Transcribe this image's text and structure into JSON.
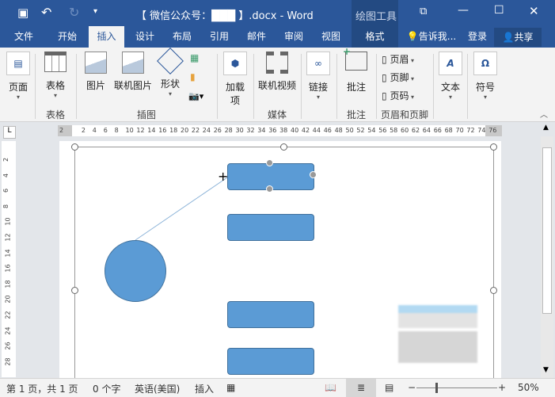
{
  "title_bar": {
    "document_title": "【 微信公众号：███ 】.docx - Word",
    "context_group": "绘图工具",
    "quick_access": [
      "save",
      "undo",
      "redo",
      "customize"
    ],
    "window_controls": [
      "ribbon-display",
      "minimize",
      "maximize",
      "close"
    ]
  },
  "tabs": [
    {
      "label": "文件"
    },
    {
      "label": "开始"
    },
    {
      "label": "插入",
      "active": true
    },
    {
      "label": "设计"
    },
    {
      "label": "布局"
    },
    {
      "label": "引用"
    },
    {
      "label": "邮件"
    },
    {
      "label": "审阅"
    },
    {
      "label": "视图"
    },
    {
      "label": "格式"
    }
  ],
  "tell_me": "告诉我...",
  "sign_in": "登录",
  "share": "共享",
  "ribbon": {
    "buttons": {
      "page": "页面",
      "table": "表格",
      "picture": "图片",
      "online_picture": "联机图片",
      "shapes": "形状",
      "addins": "加载项",
      "online_video": "联机视频",
      "link": "链接",
      "comment": "批注",
      "header": "页眉",
      "footer": "页脚",
      "page_number": "页码",
      "text": "文本",
      "symbol": "符号"
    },
    "groups": {
      "tables": "表格",
      "illustrations": "插图",
      "media": "媒体",
      "comments": "批注",
      "header_footer": "页眉和页脚"
    }
  },
  "ruler": {
    "h": [
      "2",
      "2",
      "4",
      "6",
      "8",
      "10",
      "12",
      "14",
      "16",
      "18",
      "20",
      "22",
      "24",
      "26",
      "28",
      "30",
      "32",
      "34",
      "36",
      "38",
      "40",
      "42",
      "44",
      "46",
      "48",
      "50",
      "52",
      "54",
      "56",
      "58",
      "60",
      "62",
      "64",
      "66",
      "68",
      "70",
      "72",
      "74",
      "76"
    ],
    "v": [
      "2",
      "4",
      "6",
      "8",
      "10",
      "12",
      "14",
      "16",
      "18",
      "20",
      "22",
      "24",
      "26",
      "28"
    ]
  },
  "status": {
    "page": "第 1 页，共 1 页",
    "words": "0 个字",
    "language": "英语(美国)",
    "mode": "插入",
    "zoom": "50%",
    "zoom_fraction": 0.5
  },
  "colors": {
    "brand": "#2b579a",
    "shape": "#5b9bd5"
  }
}
